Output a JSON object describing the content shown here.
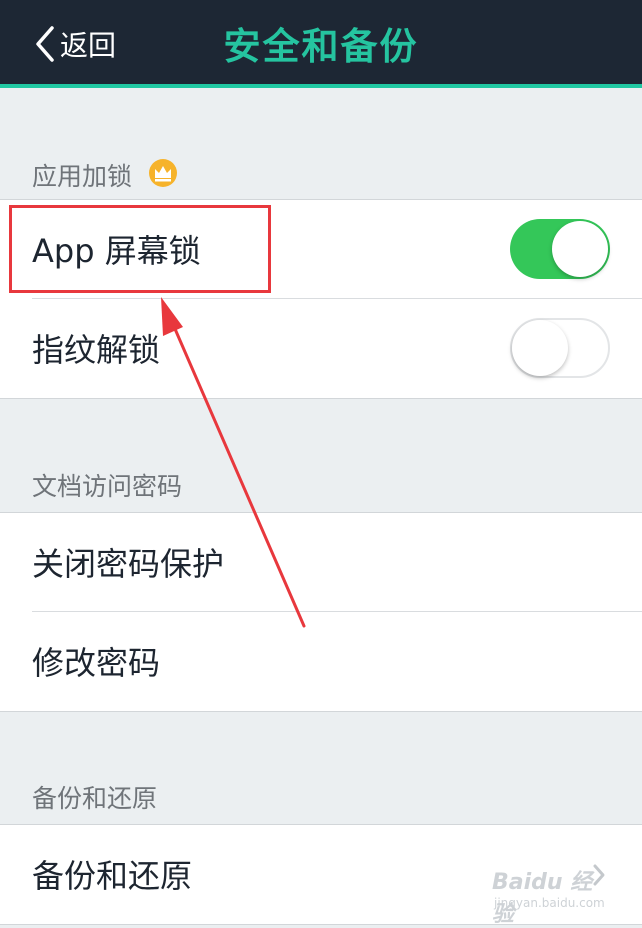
{
  "navbar": {
    "back_label": "返回",
    "title": "安全和备份"
  },
  "sections": [
    {
      "label": "应用加锁",
      "icon": "crown-icon"
    },
    {
      "label": "文档访问密码"
    },
    {
      "label": "备份和还原"
    }
  ],
  "rows": {
    "app_lock": {
      "label": "App 屏幕锁",
      "enabled": true
    },
    "fingerprint": {
      "label": "指纹解锁",
      "enabled": false
    },
    "disable_password": {
      "label": "关闭密码保护"
    },
    "change_password": {
      "label": "修改密码"
    },
    "backup_restore": {
      "label": "备份和还原",
      "icon": "chevron-right-icon"
    }
  },
  "watermark": {
    "brand": "Baidu 经验",
    "url": "jingyan.baidu.com"
  },
  "colors": {
    "navbar_bg": "#1d2734",
    "accent": "#25c4a0",
    "toggle_on": "#34c759",
    "annotation": "#e8383d",
    "page_bg": "#ebeff1"
  }
}
